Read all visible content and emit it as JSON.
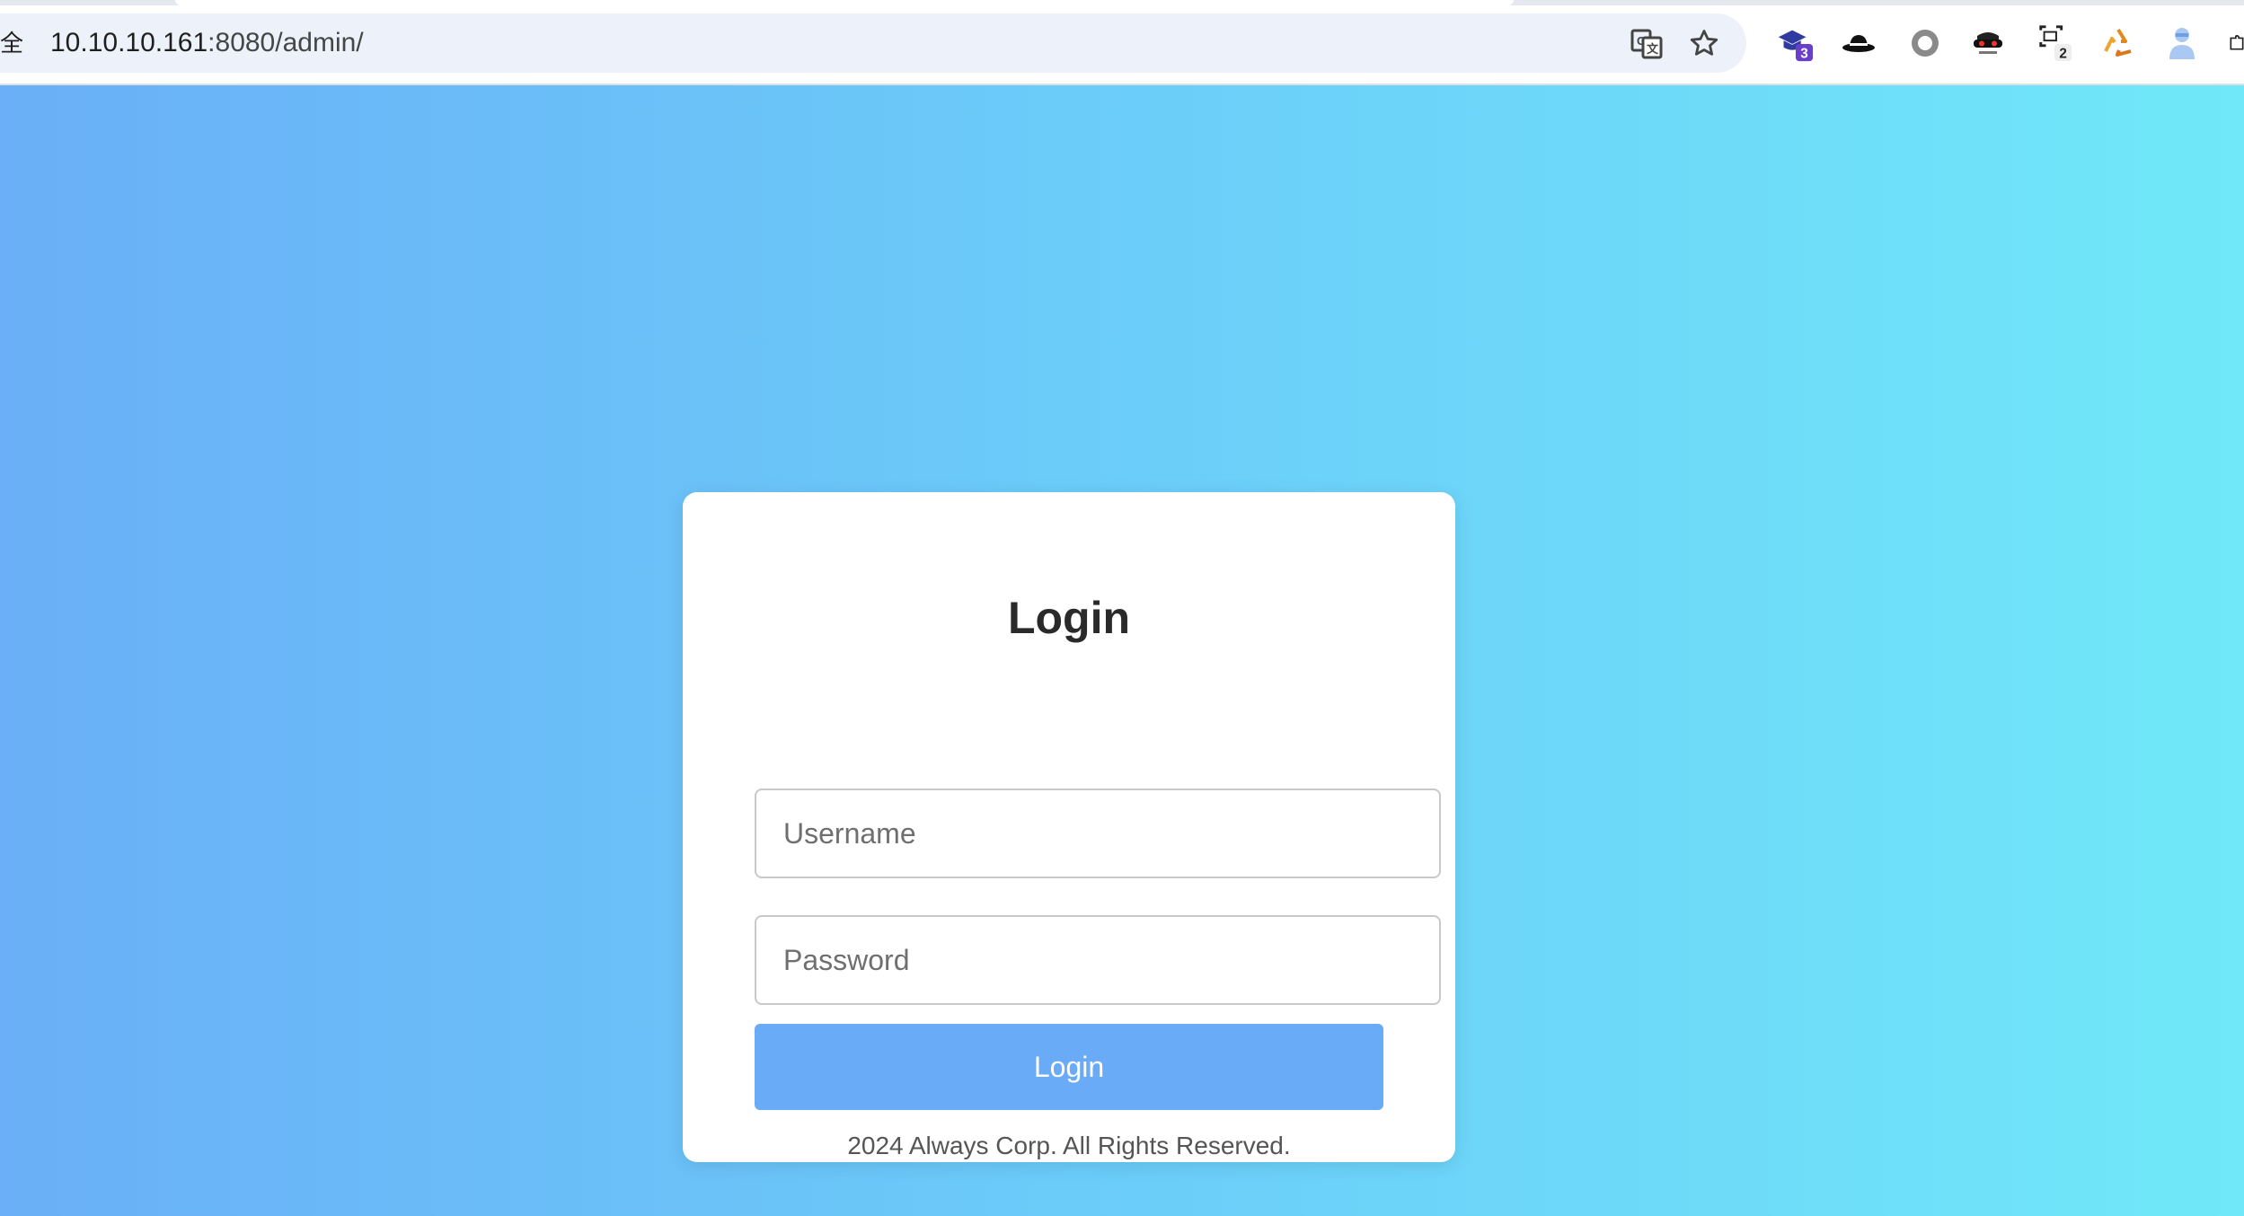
{
  "browser": {
    "site_info_glyph": "全",
    "url_host": "10.10.10.161",
    "url_rest": ":8080/admin/",
    "icons": [
      "translate-icon",
      "bookmark-star-icon"
    ],
    "extensions": [
      {
        "name": "graduation-cap-extension-icon",
        "badge": "3"
      },
      {
        "name": "hat-extension-icon",
        "badge": ""
      },
      {
        "name": "circle-extension-icon",
        "badge": ""
      },
      {
        "name": "mask-extension-icon",
        "badge": ""
      },
      {
        "name": "scanner-extension-icon",
        "badge": "2"
      },
      {
        "name": "recycle-extension-icon",
        "badge": ""
      },
      {
        "name": "person-extension-icon",
        "badge": ""
      }
    ]
  },
  "login": {
    "title": "Login",
    "username_placeholder": "Username",
    "password_placeholder": "Password",
    "submit_label": "Login",
    "footer": "2024 Always Corp. All Rights Reserved."
  },
  "colors": {
    "gradient_start": "#6aaff7",
    "gradient_end": "#70e8f9",
    "button": "#6aabf7",
    "card": "#ffffff"
  }
}
